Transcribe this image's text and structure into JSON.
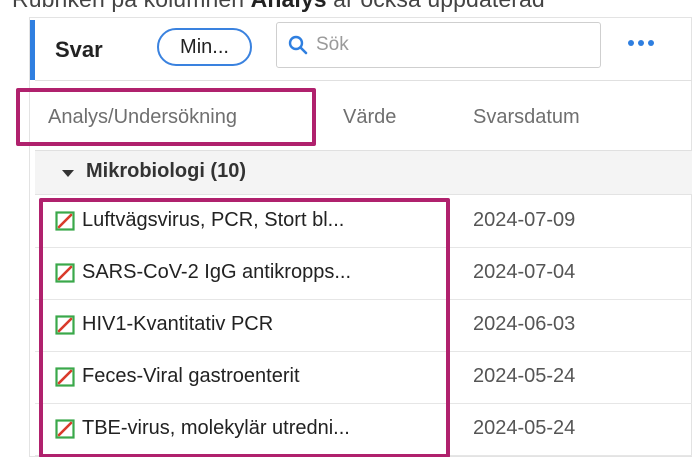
{
  "doc_caption": {
    "before": "Rubriken på kolumnen",
    "bold": "Analys",
    "after": "är ocksa uppdaterad"
  },
  "toolbar": {
    "title": "Svar",
    "filter_pill": "Min...",
    "search_placeholder": "Sök"
  },
  "columns": {
    "analysis": "Analys/Undersökning",
    "value": "Värde",
    "date": "Svarsdatum"
  },
  "group": {
    "label": "Mikrobiologi (10)"
  },
  "rows": [
    {
      "name": "Luftvägsvirus, PCR, Stort bl...",
      "date": "2024-07-09"
    },
    {
      "name": "SARS-CoV-2 IgG antikropps...",
      "date": "2024-07-04"
    },
    {
      "name": "HIV1-Kvantitativ PCR",
      "date": "2024-06-03"
    },
    {
      "name": "Feces-Viral gastroenterit",
      "date": "2024-05-24"
    },
    {
      "name": "TBE-virus, molekylär utredni...",
      "date": "2024-05-24"
    }
  ],
  "colors": {
    "accent": "#2f7fe0",
    "highlight": "#b0216d",
    "icon_border": "#3aa84a",
    "icon_slash": "#d93a2b"
  },
  "icons": {
    "search": "search-icon",
    "more": "more-dots-icon",
    "status": "status-flag-icon",
    "caret": "caret-down-icon"
  }
}
